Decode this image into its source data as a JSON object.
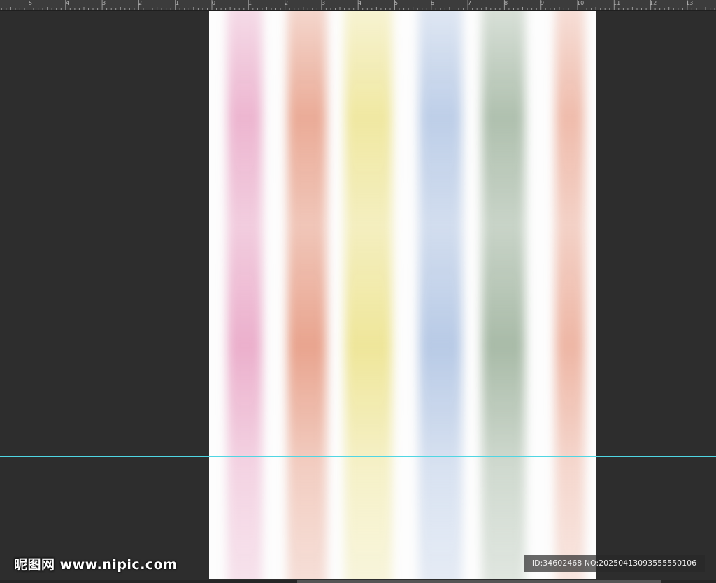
{
  "ruler": {
    "labels": [
      "5",
      "4",
      "3",
      "2",
      "1",
      "0",
      "1",
      "2",
      "3",
      "4",
      "5",
      "6",
      "7",
      "8",
      "9",
      "10",
      "11",
      "12",
      "13"
    ]
  },
  "artboard": {
    "stripes": [
      {
        "name": "pink",
        "color": "#e8a3c4"
      },
      {
        "name": "coral",
        "color": "#e5967d"
      },
      {
        "name": "yellow",
        "color": "#ece28a"
      },
      {
        "name": "blue",
        "color": "#adc2e2"
      },
      {
        "name": "green",
        "color": "#9bb09a"
      },
      {
        "name": "salmon",
        "color": "#ebab97"
      }
    ]
  },
  "watermark": {
    "brand": "昵图网 www.nipic.com",
    "id_text": "ID:34602468 NO:20250413093555550106"
  },
  "colors": {
    "guide": "#4fd6e3",
    "pasteboard": "#2d2d2d",
    "ruler_bg": "#3c3c3c"
  }
}
